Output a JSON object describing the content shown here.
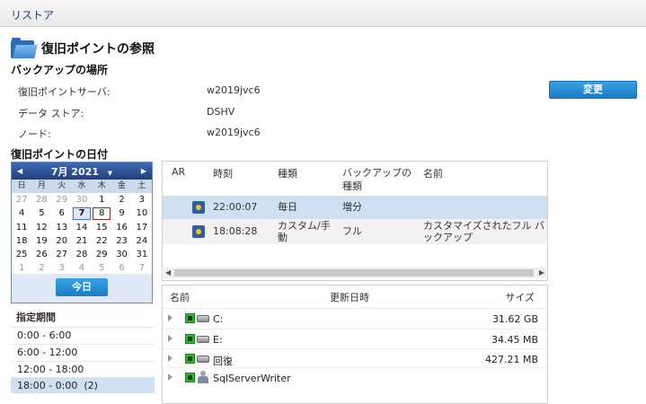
{
  "window": {
    "title": "リストア"
  },
  "header": {
    "title": "復旧ポイントの参照",
    "icon": "folder-icon"
  },
  "backup_location": {
    "section_title": "バックアップの場所",
    "server_label": "復旧ポイントサーバ:",
    "server_value": "w2019jvc6",
    "datastore_label": "データ ストア:",
    "datastore_value": "DSHV",
    "node_label": "ノード:",
    "node_value": "w2019jvc6",
    "change_button": "変更"
  },
  "calendar": {
    "section_title": "復旧ポイントの日付",
    "month_label": "7月 2021",
    "prev": "◀",
    "next": "▶",
    "dropdown": "▼",
    "weekdays": [
      "日",
      "月",
      "火",
      "水",
      "木",
      "金",
      "土"
    ],
    "weeks": [
      [
        "27",
        "28",
        "29",
        "30",
        "1",
        "2",
        "3"
      ],
      [
        "4",
        "5",
        "6",
        "7",
        "8",
        "9",
        "10"
      ],
      [
        "11",
        "12",
        "13",
        "14",
        "15",
        "16",
        "17"
      ],
      [
        "18",
        "19",
        "20",
        "21",
        "22",
        "23",
        "24"
      ],
      [
        "25",
        "26",
        "27",
        "28",
        "29",
        "30",
        "31"
      ],
      [
        "1",
        "2",
        "3",
        "4",
        "5",
        "6",
        "7"
      ]
    ],
    "today_button": "今日"
  },
  "periods": {
    "title": "指定期間",
    "items": [
      "0:00 - 6:00",
      "6:00 - 12:00",
      "12:00 - 18:00",
      "18:00 - 0:00  (2)"
    ]
  },
  "points_table": {
    "headers": {
      "ar": "AR",
      "time": "時刻",
      "type": "種類",
      "backup_type": "バックアップの種類",
      "name": "名前"
    },
    "rows": [
      {
        "time": "22:00:07",
        "type": "毎日",
        "backup_type": "増分",
        "name": ""
      },
      {
        "time": "18:08:28",
        "type": "カスタム/手動",
        "backup_type": "フル",
        "name": "カスタマイズされたフル バックアップ"
      }
    ]
  },
  "files_table": {
    "headers": {
      "name": "名前",
      "modified": "更新日時",
      "size": "サイズ"
    },
    "rows": [
      {
        "name": "C:",
        "size": "31.62 GB",
        "icon": "drive-icon"
      },
      {
        "name": "E:",
        "size": "34.45 MB",
        "icon": "drive-icon"
      },
      {
        "name": "回復",
        "size": "427.21 MB",
        "icon": "drive-icon"
      },
      {
        "name": "SqlServerWriter",
        "size": "",
        "icon": "writer-icon"
      }
    ]
  }
}
